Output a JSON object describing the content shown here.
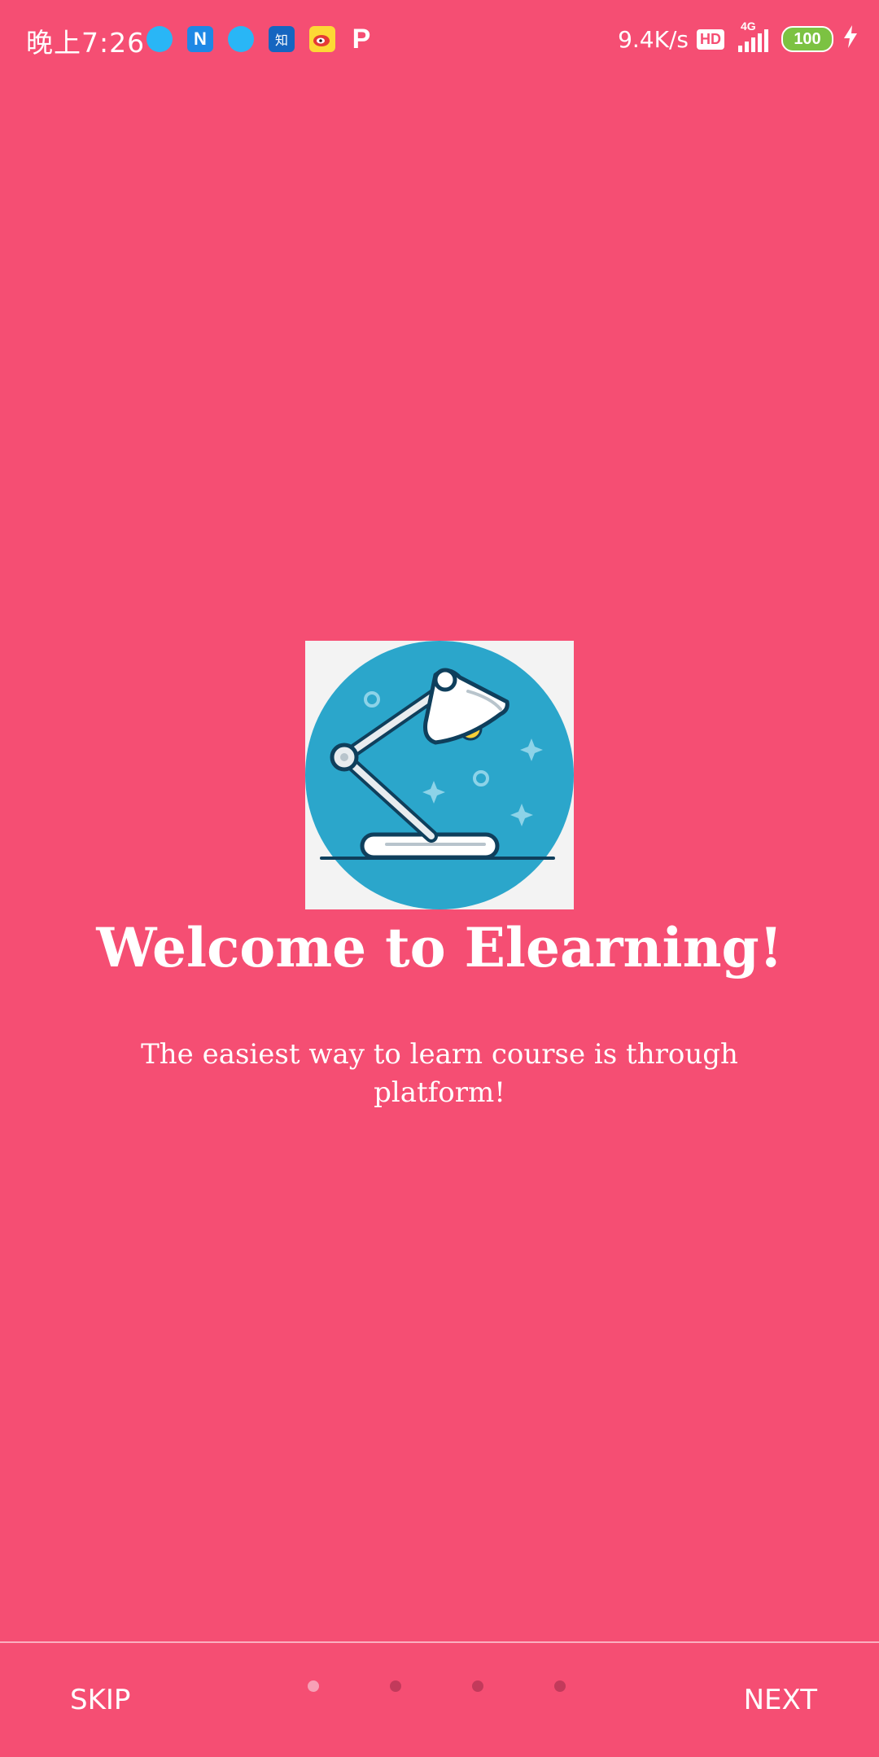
{
  "status_bar": {
    "time": "晚上7:26",
    "notification_icons": [
      "bubble-app-icon",
      "n-app-icon",
      "bubble-app-icon",
      "zhihu-icon",
      "weibo-icon",
      "p-app-icon"
    ],
    "zhihu_glyph": "知",
    "n_glyph": "N",
    "p_glyph": "P",
    "net_speed": "9.4K/s",
    "hd_badge": "HD",
    "network_type": "4G",
    "battery_level": "100",
    "charging_icon": "bolt-icon"
  },
  "onboarding": {
    "illustration_icon": "desk-lamp-icon",
    "title": "Welcome to Elearning!",
    "subtitle": "The easiest way to learn course is through platform!",
    "page_count": 4,
    "active_page": 1
  },
  "bottom_nav": {
    "skip_label": "SKIP",
    "next_label": "NEXT"
  },
  "colors": {
    "background": "#F54E73",
    "illustration_circle": "#2BA6CB",
    "dot_active": "#F7A0B6",
    "dot_inactive": "#C23A5B",
    "battery": "#7CC242"
  }
}
